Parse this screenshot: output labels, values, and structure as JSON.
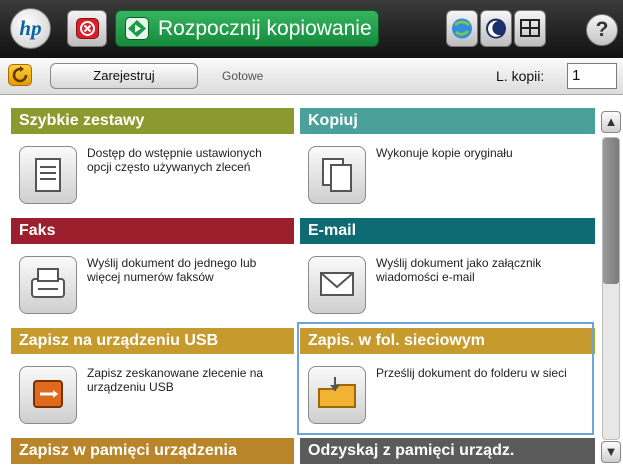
{
  "header": {
    "logo": "hp",
    "stop_icon": "stop-icon",
    "start_copy_label": "Rozpocznij kopiowanie",
    "start_icon": "start-icon",
    "help_label": "?",
    "buttons": [
      "network-icon",
      "sleep-icon",
      "layout-icon"
    ]
  },
  "status": {
    "sign_in_label": "Zarejestruj",
    "state_text": "Gotowe",
    "copies_label": "L. kopii:",
    "copies_value": "1"
  },
  "tiles": [
    {
      "title": "Szybkie zestawy",
      "desc": "Dostęp do wstępnie ustawionych opcji często używanych zleceń",
      "color": "#8a9a2f"
    },
    {
      "title": "Kopiuj",
      "desc": "Wykonuje kopie oryginału",
      "color": "#4aa19a"
    },
    {
      "title": "Faks",
      "desc": "Wyślij dokument do jednego lub więcej numerów faksów",
      "color": "#9b1f2d"
    },
    {
      "title": "E-mail",
      "desc": "Wyślij dokument jako załącznik wiadomości e-mail",
      "color": "#0f6b73"
    },
    {
      "title": "Zapisz na urządzeniu USB",
      "desc": "Zapisz zeskanowane zlecenie na urządzeniu USB",
      "color": "#c79a2d"
    },
    {
      "title": "Zapis. w fol. sieciowym",
      "desc": "Prześlij dokument do folderu w sieci",
      "color": "#c79a2d"
    },
    {
      "title": "Zapisz w pamięci urządzenia",
      "color": "#b9852a"
    },
    {
      "title": "Odzyskaj z pamięci urządz.",
      "color": "#5b5b5b"
    }
  ]
}
